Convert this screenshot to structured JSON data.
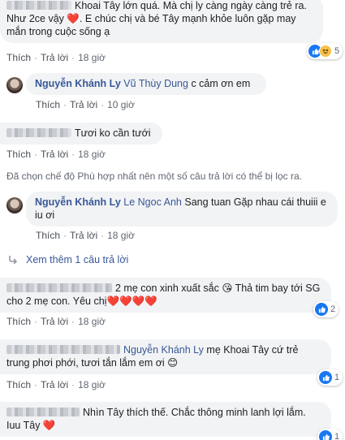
{
  "c1": {
    "text": "Khoai Tây lớn quá. Mà chị ly càng ngày càng trẻ ra. Như 2ce vậy ❤️. E chúc chị và bé Tây mạnh khỏe luôn gặp may mắn trong cuộc sống ạ",
    "like": "Thích",
    "reply": "Trả lời",
    "time": "18 giờ",
    "reaction_count": "5"
  },
  "r1": {
    "author": "Nguyễn Khánh Ly",
    "mention": "Vũ Thùy Dung",
    "text": "c cảm ơn em",
    "like": "Thích",
    "reply": "Trả lời",
    "time": "10 giờ"
  },
  "c2": {
    "text": "Tươi ko cần tưới",
    "like": "Thích",
    "reply": "Trả lời",
    "time": "18 giờ"
  },
  "filter_note": "Đã chọn chế độ Phù hợp nhất nên một số câu trả lời có thể bị lọc ra.",
  "r2": {
    "author": "Nguyễn Khánh Ly",
    "mention": "Le Ngoc Anh",
    "text": "Sang tuan Gặp nhau cái thuiii e iu ơi",
    "like": "Thích",
    "reply": "Trả lời",
    "time": "18 giờ"
  },
  "more_replies": "Xem thêm 1 câu trả lời",
  "c3": {
    "text": "2 mẹ con xinh xuất sắc 😘 Thả tim bay tới SG cho 2 mẹ con. Yêu chị❤️❤️❤️❤️",
    "like": "Thích",
    "reply": "Trả lời",
    "time": "18 giờ",
    "reaction_count": "2"
  },
  "c4": {
    "mention": "Nguyễn Khánh Ly",
    "text": "mẹ Khoai Tây cứ trẻ trung phơi phới, tươi tắn lắm em ơi 😊",
    "like": "Thích",
    "reply": "Trả lời",
    "time": "18 giờ",
    "reaction_count": "1"
  },
  "c5": {
    "text": "Nhìn Tây thích thế. Chắc thông minh lanh lợi lắm. Iuu Tây ❤️",
    "reaction_count": "1"
  },
  "colors": {
    "link": "#385898",
    "bubble": "#f2f3f5",
    "like_blue": "#1877f2"
  }
}
